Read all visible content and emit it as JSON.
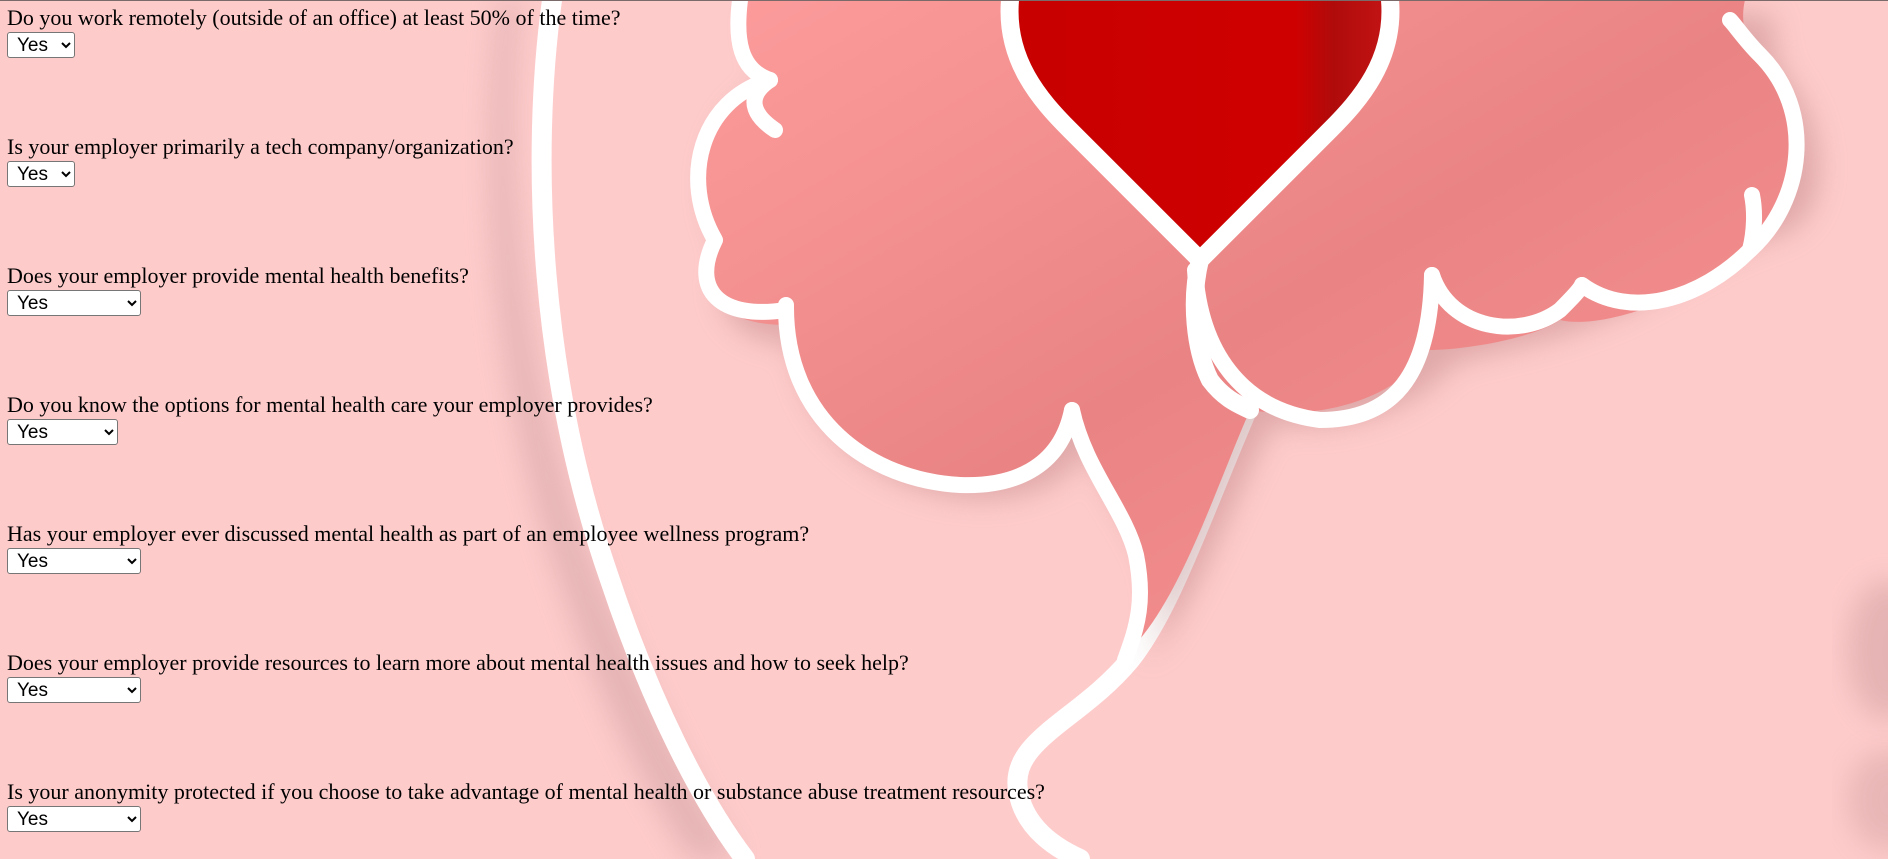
{
  "questions": [
    {
      "id": "remote_work",
      "label": "Do you work remotely (outside of an office) at least 50% of the time?",
      "selected": "Yes",
      "options": [
        "Yes"
      ]
    },
    {
      "id": "tech_company",
      "label": "Is your employer primarily a tech company/organization?",
      "selected": "Yes",
      "options": [
        "Yes"
      ]
    },
    {
      "id": "benefits",
      "label": "Does your employer provide mental health benefits?",
      "selected": "Yes",
      "options": [
        "Yes"
      ]
    },
    {
      "id": "care_options",
      "label": "Do you know the options for mental health care your employer provides?",
      "selected": "Yes",
      "options": [
        "Yes"
      ]
    },
    {
      "id": "wellness_program",
      "label": "Has your employer ever discussed mental health as part of an employee wellness program?",
      "selected": "Yes",
      "options": [
        "Yes"
      ]
    },
    {
      "id": "seek_help",
      "label": "Does your employer provide resources to learn more about mental health issues and how to seek help?",
      "selected": "Yes",
      "options": [
        "Yes"
      ]
    },
    {
      "id": "anonymity",
      "label": "Is your anonymity protected if you choose to take advantage of mental health or substance abuse treatment resources?",
      "selected": "Yes",
      "options": [
        "Yes"
      ]
    }
  ],
  "colors": {
    "background": "#fecbcb",
    "brain": "#fd9898",
    "brain_shadow": "#e07a7a",
    "heart": "#cc0000",
    "outline": "#ffffff"
  },
  "icons": {
    "background": "brain-heart-illustration"
  }
}
